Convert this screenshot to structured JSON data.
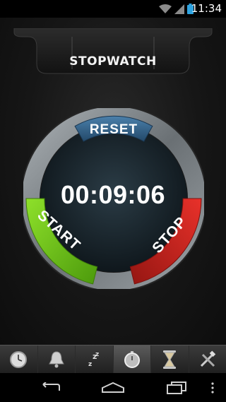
{
  "status_bar": {
    "time": "11:34",
    "icons": [
      "wifi-icon",
      "signal-icon",
      "battery-icon"
    ]
  },
  "header": {
    "title": "STOPWATCH"
  },
  "dial": {
    "reset_label": "RESET",
    "start_label": "START",
    "stop_label": "STOP",
    "readout": "00:09:06",
    "colors": {
      "reset": "#2f5f86",
      "start": "#6cc416",
      "stop": "#c8211e",
      "ring": "#8c9296",
      "face": "#1d2d36"
    }
  },
  "tabs": [
    {
      "name": "clock",
      "icon": "clock-icon",
      "active": false
    },
    {
      "name": "alarm",
      "icon": "bell-icon",
      "active": false
    },
    {
      "name": "sleep",
      "icon": "sleep-zzz-icon",
      "active": false
    },
    {
      "name": "stopwatch",
      "icon": "stopwatch-icon",
      "active": true
    },
    {
      "name": "timer",
      "icon": "hourglass-icon",
      "active": false
    },
    {
      "name": "tools",
      "icon": "tools-icon",
      "active": false
    }
  ],
  "nav": [
    "back-icon",
    "home-icon",
    "recents-icon",
    "menu-icon"
  ]
}
